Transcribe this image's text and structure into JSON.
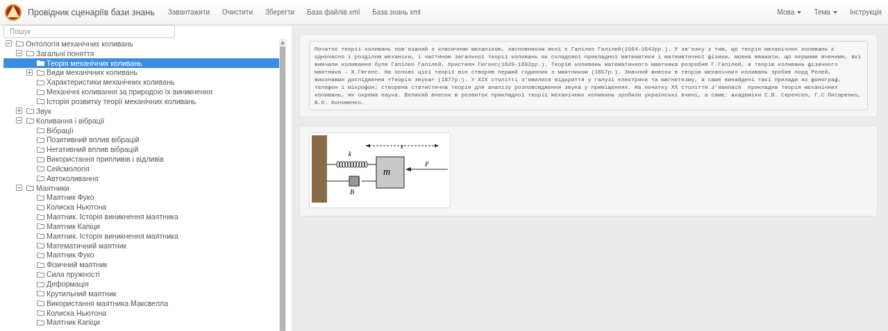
{
  "navbar": {
    "brand": "Провідник сценаріїв бази знань",
    "menu": [
      {
        "label": "Завантажити"
      },
      {
        "label": "Очистити"
      },
      {
        "label": "Зберегти"
      },
      {
        "label": "База файлів xml"
      },
      {
        "label": "База знань xml"
      }
    ],
    "right_menu": [
      {
        "label": "Мова",
        "dropdown": true
      },
      {
        "label": "Тема",
        "dropdown": true
      },
      {
        "label": "Інструкція",
        "dropdown": false
      }
    ]
  },
  "search": {
    "placeholder": "Пошук"
  },
  "tree": [
    {
      "label": "Онтологія механічних коливань",
      "expanded": true,
      "selected": false,
      "children": [
        {
          "label": "Загальні поняття",
          "expanded": true,
          "selected": false,
          "children": [
            {
              "label": "Теорія механічних коливань",
              "selected": true
            },
            {
              "label": "Види механічних коливань",
              "expanded": false,
              "selected": false
            },
            {
              "label": "Характеристики механічних коливань",
              "selected": false
            },
            {
              "label": "Механічні коливання за природою їх виникнення",
              "selected": false
            },
            {
              "label": "Історія розвитку теорії механічних коливань",
              "selected": false
            }
          ]
        },
        {
          "label": "Звук",
          "expanded": false,
          "selected": false
        },
        {
          "label": "Коливання і вібрації",
          "expanded": true,
          "selected": false,
          "children": [
            {
              "label": "Вібрації",
              "selected": false
            },
            {
              "label": "Позитивний вплив вібрацій",
              "selected": false
            },
            {
              "label": "Негативний вплив вібрацій",
              "selected": false
            },
            {
              "label": "Використання припливів і відливів",
              "selected": false
            },
            {
              "label": "Сейсмологія",
              "selected": false
            },
            {
              "label": "Автоколивання",
              "selected": false
            }
          ]
        },
        {
          "label": "Маятники",
          "expanded": true,
          "selected": false,
          "children": [
            {
              "label": "Маятник Фуко",
              "selected": false
            },
            {
              "label": "Колиска Ньютона",
              "selected": false
            },
            {
              "label": "Маятник. Історія виникнення маятника",
              "selected": false
            },
            {
              "label": "Маятник Капіци",
              "selected": false
            },
            {
              "label": "Маятник. Історія виникнення маятника",
              "selected": false
            },
            {
              "label": "Математичний маятник",
              "selected": false
            },
            {
              "label": "Маятник Фуко",
              "selected": false
            },
            {
              "label": "Фізичний маятник",
              "selected": false
            },
            {
              "label": "Сила пружності",
              "selected": false
            },
            {
              "label": "Деформація",
              "selected": false
            },
            {
              "label": "Крутильний маятник",
              "selected": false
            },
            {
              "label": "Використання маятника Максвелла",
              "selected": false
            },
            {
              "label": "Колиска Ньютона",
              "selected": false
            },
            {
              "label": "Маятник Капіци",
              "selected": false
            }
          ]
        }
      ]
    }
  ],
  "article": {
    "lines": [
      "Початок теорії коливань пов'язаний з класичною механікою, засновником якої є Галілео Галілей(1564-1642рр.). У зв’язку з тим, що теорія механічних коливань є",
      "одночасно і розділом механіки, і частиною загальної теорії коливань як складової прикладної математики і математичної фізики, можна вважати, що першими вченими, які",
      "вивчали коливання були Галілео Галілей, Християн Гюгенс(1629-1692рр.). Теорію коливань математичного маятника розробив Г.Галілей, а теорію коливань фізичного",
      "маятника - Х.Гюгенс. На основі цієї теорії він створив перший годинник з маятником (1657р.). Значний внесок в теорію механічних коливань зробив лорд Релей,",
      "виконавши дослідження «Теорія звука» (1877р.). У XIX столітті з’явилися відкриття у галузі електрики та магнетизму, а саме винайдені такі прилади як фонограф,",
      "телефон і мікрофон; створена статистична теорія для аналізу розповсюдження звука у приміщеннях. На початку XX століття з’явилася  прикладна теорія механічних",
      "коливань, як окрема наука. Великий внесок в розвиток прикладної теорії механічних коливань зробили українські вчені, а саме: академіки С.В. Серенсен, Г.С Писаренко,",
      "В.О. Кономенко."
    ]
  },
  "figure": {
    "labels": [
      {
        "kind": "spring",
        "text": "k"
      },
      {
        "kind": "displacement",
        "text": "x"
      },
      {
        "kind": "mass",
        "text": "m"
      },
      {
        "kind": "damper",
        "text": "B"
      },
      {
        "kind": "force",
        "text": "F"
      }
    ]
  }
}
